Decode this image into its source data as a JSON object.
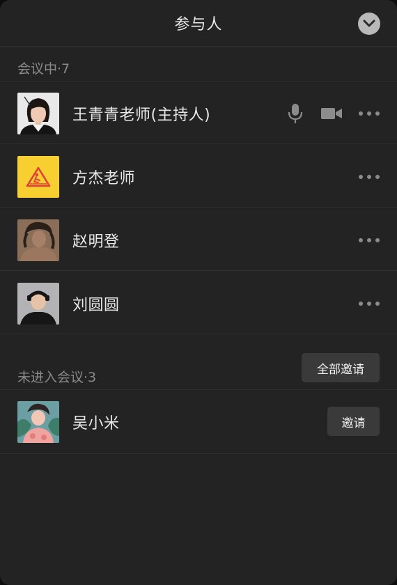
{
  "header": {
    "title": "参与人",
    "collapse_icon": "chevron-down-icon"
  },
  "in_meeting": {
    "label": "会议中·7",
    "participants": [
      {
        "name": "王青青老师(主持人)",
        "avatar": "portrait-woman-avatar",
        "mic_icon": "microphone-icon",
        "camera_icon": "video-camera-icon",
        "more_icon": "more-dots-icon"
      },
      {
        "name": "方杰老师",
        "avatar": "warning-sign-avatar",
        "more_icon": "more-dots-icon"
      },
      {
        "name": "赵明登",
        "avatar": "portrait-man-avatar",
        "more_icon": "more-dots-icon"
      },
      {
        "name": "刘圆圆",
        "avatar": "portrait-man-headphones-avatar",
        "more_icon": "more-dots-icon"
      }
    ]
  },
  "not_joined": {
    "label": "未进入会议·3",
    "invite_all_label": "全部邀请",
    "participants": [
      {
        "name": "吴小米",
        "avatar": "illustration-avatar",
        "invite_label": "邀请"
      }
    ]
  },
  "colors": {
    "panel_bg": "#232323",
    "text_primary": "#e8e8e8",
    "text_secondary": "#8a8a8a",
    "button_bg": "#3a3a3a",
    "avatar_yellow": "#f7cf30"
  }
}
